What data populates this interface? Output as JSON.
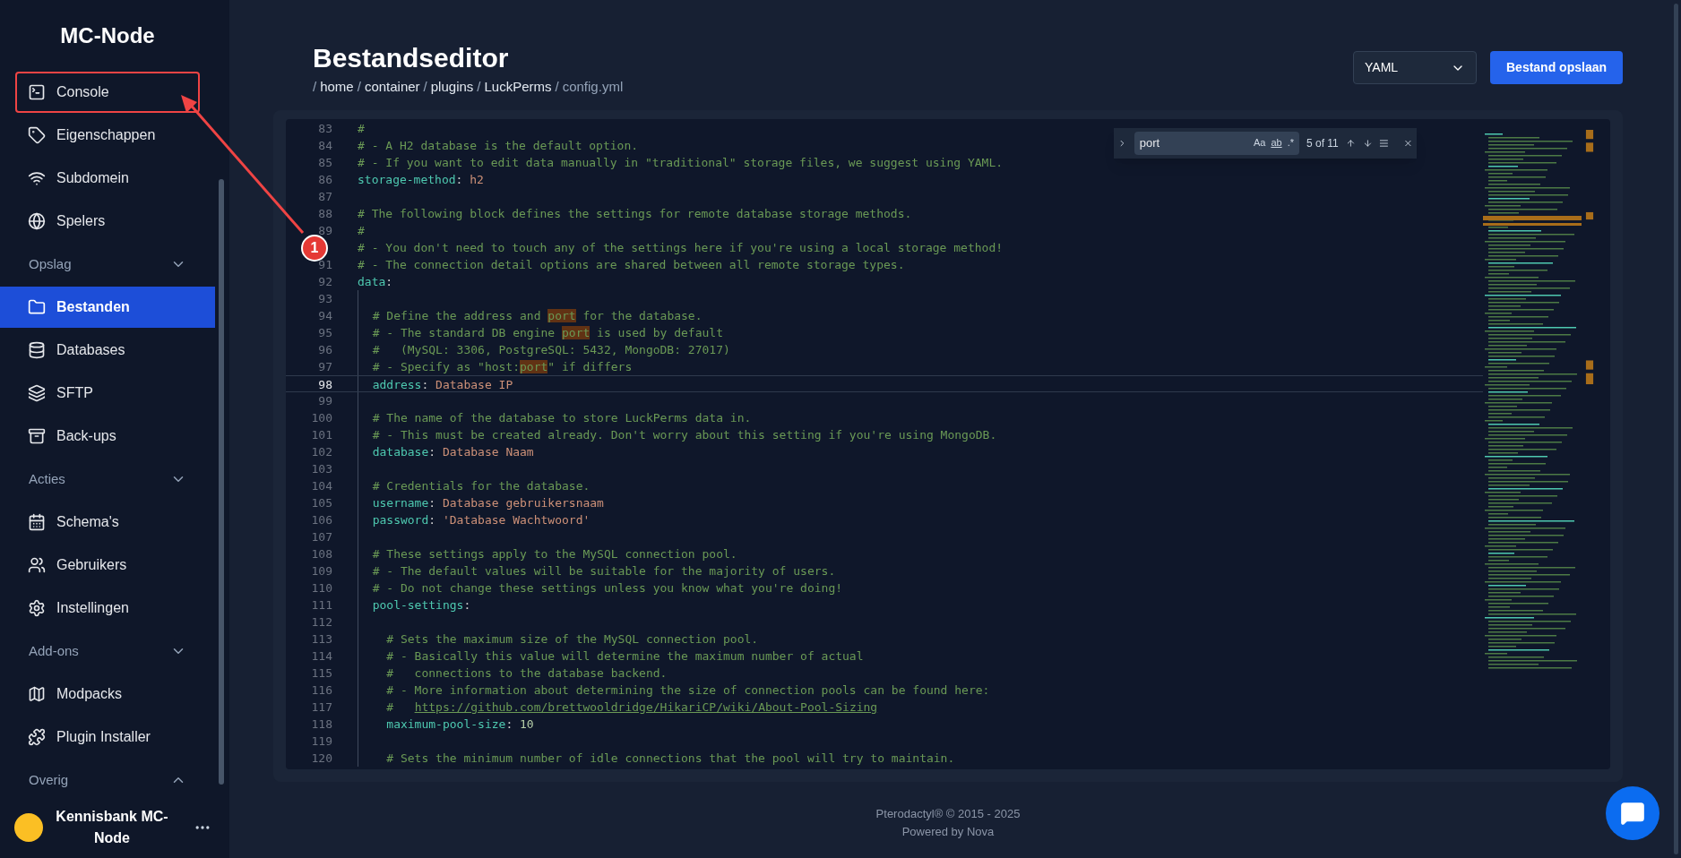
{
  "sidebar": {
    "brand": "MC-Node",
    "items": [
      {
        "label": "Console",
        "selected": false,
        "annotated": true
      },
      {
        "label": "Eigenschappen",
        "selected": false,
        "annotated": false
      },
      {
        "label": "Subdomein",
        "selected": false,
        "annotated": false
      },
      {
        "label": "Spelers",
        "selected": false,
        "annotated": false
      }
    ],
    "sections": [
      {
        "title": "Opslag",
        "expanded": true,
        "items": [
          {
            "label": "Bestanden",
            "selected": true,
            "annotated": false
          },
          {
            "label": "Databases",
            "selected": false,
            "annotated": false
          },
          {
            "label": "SFTP",
            "selected": false,
            "annotated": false
          },
          {
            "label": "Back-ups",
            "selected": false,
            "annotated": false
          }
        ]
      },
      {
        "title": "Acties",
        "expanded": true,
        "items": [
          {
            "label": "Schema's",
            "selected": false,
            "annotated": false
          },
          {
            "label": "Gebruikers",
            "selected": false,
            "annotated": false
          },
          {
            "label": "Instellingen",
            "selected": false,
            "annotated": false
          }
        ]
      },
      {
        "title": "Add-ons",
        "expanded": true,
        "items": [
          {
            "label": "Modpacks",
            "selected": false,
            "annotated": false
          },
          {
            "label": "Plugin Installer",
            "selected": false,
            "annotated": false
          }
        ]
      },
      {
        "title": "Overig",
        "expanded": false
      }
    ],
    "user": {
      "name": "Kennisbank MC-Node"
    }
  },
  "annotation": {
    "badge": "1"
  },
  "header": {
    "title": "Bestandseditor",
    "separator": "/",
    "breadcrumb": [
      {
        "label": "home",
        "link": true
      },
      {
        "label": "container",
        "link": true
      },
      {
        "label": "plugins",
        "link": true
      },
      {
        "label": "LuckPerms",
        "link": true
      },
      {
        "label": "config.yml",
        "link": false
      }
    ],
    "language": "YAML",
    "save": "Bestand opslaan"
  },
  "find": {
    "value": "port",
    "case": "Aa",
    "word": "ab",
    "regex": ".*",
    "count": "5 of 11"
  },
  "lines": [
    {
      "n": "83",
      "current": false,
      "parts": [
        {
          "kind": "comment",
          "s": "#"
        }
      ]
    },
    {
      "n": "84",
      "current": false,
      "parts": [
        {
          "kind": "comment",
          "s": "# - A H2 database is the default option."
        }
      ]
    },
    {
      "n": "85",
      "current": false,
      "parts": [
        {
          "kind": "comment",
          "s": "# - If you want to edit data manually in \"traditional\" storage files, we suggest using YAML."
        }
      ]
    },
    {
      "n": "86",
      "current": false,
      "parts": [
        {
          "kind": "key",
          "s": "storage-method"
        },
        {
          "kind": "punct",
          "s": ": "
        },
        {
          "kind": "value",
          "s": "h2"
        }
      ]
    },
    {
      "n": "87",
      "current": false
    },
    {
      "n": "88",
      "current": false,
      "parts": [
        {
          "kind": "comment",
          "s": "# The following block defines the settings for remote database storage methods."
        }
      ]
    },
    {
      "n": "89",
      "current": false,
      "parts": [
        {
          "kind": "comment",
          "s": "#"
        }
      ]
    },
    {
      "current": false,
      "parts": [
        {
          "kind": "comment",
          "s": "# - You don't need to touch any of the settings here if you're using a local storage method!"
        }
      ]
    },
    {
      "n": "91",
      "current": false,
      "parts": [
        {
          "kind": "comment",
          "s": "# - The connection detail options are shared between all remote storage types."
        }
      ]
    },
    {
      "n": "92",
      "current": false,
      "parts": [
        {
          "kind": "key",
          "s": "data"
        },
        {
          "kind": "punct",
          "s": ":"
        }
      ]
    },
    {
      "n": "93",
      "current": false
    },
    {
      "n": "94",
      "current": false,
      "parts": [
        {
          "kind": "comment",
          "s": "  # Define the address and "
        },
        {
          "kind": "match",
          "s": "port"
        },
        {
          "kind": "comment",
          "s": " for the database."
        }
      ]
    },
    {
      "n": "95",
      "current": false,
      "parts": [
        {
          "kind": "comment",
          "s": "  # - The standard DB engine "
        },
        {
          "kind": "match",
          "s": "port"
        },
        {
          "kind": "comment",
          "s": " is used by default"
        }
      ]
    },
    {
      "n": "96",
      "current": false,
      "parts": [
        {
          "kind": "comment",
          "s": "  #   (MySQL: 3306, PostgreSQL: 5432, MongoDB: 27017)"
        }
      ]
    },
    {
      "n": "97",
      "current": false,
      "parts": [
        {
          "kind": "comment",
          "s": "  # - Specify as \"host:"
        },
        {
          "kind": "match",
          "s": "port"
        },
        {
          "kind": "comment",
          "s": "\" if differs"
        }
      ]
    },
    {
      "n": "98",
      "current": true,
      "parts": [
        {
          "kind": "key",
          "s": "  address"
        },
        {
          "kind": "punct",
          "s": ": "
        },
        {
          "kind": "value",
          "s": "Database IP"
        }
      ]
    },
    {
      "n": "99",
      "current": false
    },
    {
      "n": "100",
      "current": false,
      "parts": [
        {
          "kind": "comment",
          "s": "  # The name of the database to store LuckPerms data in."
        }
      ]
    },
    {
      "n": "101",
      "current": false,
      "parts": [
        {
          "kind": "comment",
          "s": "  # - This must be created already. Don't worry about this setting if you're using MongoDB."
        }
      ]
    },
    {
      "n": "102",
      "current": false,
      "parts": [
        {
          "kind": "key",
          "s": "  database"
        },
        {
          "kind": "punct",
          "s": ": "
        },
        {
          "kind": "value",
          "s": "Database Naam"
        }
      ]
    },
    {
      "n": "103",
      "current": false
    },
    {
      "n": "104",
      "current": false,
      "parts": [
        {
          "kind": "comment",
          "s": "  # Credentials for the database."
        }
      ]
    },
    {
      "n": "105",
      "current": false,
      "parts": [
        {
          "kind": "key",
          "s": "  username"
        },
        {
          "kind": "punct",
          "s": ": "
        },
        {
          "kind": "value",
          "s": "Database gebruikersnaam"
        }
      ]
    },
    {
      "n": "106",
      "current": false,
      "parts": [
        {
          "kind": "key",
          "s": "  password"
        },
        {
          "kind": "punct",
          "s": ": "
        },
        {
          "kind": "value",
          "s": "'Database Wachtwoord'"
        }
      ]
    },
    {
      "n": "107",
      "current": false
    },
    {
      "n": "108",
      "current": false,
      "parts": [
        {
          "kind": "comment",
          "s": "  # These settings apply to the MySQL connection pool."
        }
      ]
    },
    {
      "n": "109",
      "current": false,
      "parts": [
        {
          "kind": "comment",
          "s": "  # - The default values will be suitable for the majority of users."
        }
      ]
    },
    {
      "n": "110",
      "current": false,
      "parts": [
        {
          "kind": "comment",
          "s": "  # - Do not change these settings unless you know what you're doing!"
        }
      ]
    },
    {
      "n": "111",
      "current": false,
      "parts": [
        {
          "kind": "key",
          "s": "  pool-settings"
        },
        {
          "kind": "punct",
          "s": ":"
        }
      ]
    },
    {
      "n": "112",
      "current": false
    },
    {
      "n": "113",
      "current": false,
      "parts": [
        {
          "kind": "comment",
          "s": "    # Sets the maximum size of the MySQL connection pool."
        }
      ]
    },
    {
      "n": "114",
      "current": false,
      "parts": [
        {
          "kind": "comment",
          "s": "    # - Basically this value will determine the maximum number of actual"
        }
      ]
    },
    {
      "n": "115",
      "current": false,
      "parts": [
        {
          "kind": "comment",
          "s": "    #   connections to the database backend."
        }
      ]
    },
    {
      "n": "116",
      "current": false,
      "parts": [
        {
          "kind": "comment",
          "s": "    # - More information about determining the size of connection pools can be found here:"
        }
      ]
    },
    {
      "n": "117",
      "current": false,
      "parts": [
        {
          "kind": "comment",
          "s": "    #   "
        },
        {
          "kind": "link",
          "s": "https://github.com/brettwooldridge/HikariCP/wiki/About-Pool-Sizing"
        }
      ]
    },
    {
      "n": "118",
      "current": false,
      "parts": [
        {
          "kind": "key",
          "s": "    maximum-pool-size"
        },
        {
          "kind": "punct",
          "s": ": "
        },
        {
          "kind": "number",
          "s": "10"
        }
      ]
    },
    {
      "n": "119",
      "current": false
    },
    {
      "n": "120",
      "current": false,
      "parts": [
        {
          "kind": "comment",
          "s": "    # Sets the minimum number of idle connections that the pool will try to maintain."
        }
      ]
    }
  ],
  "footer": {
    "copyright": "Pterodactyl® © 2015 - 2025",
    "powered": "Powered by Nova"
  }
}
